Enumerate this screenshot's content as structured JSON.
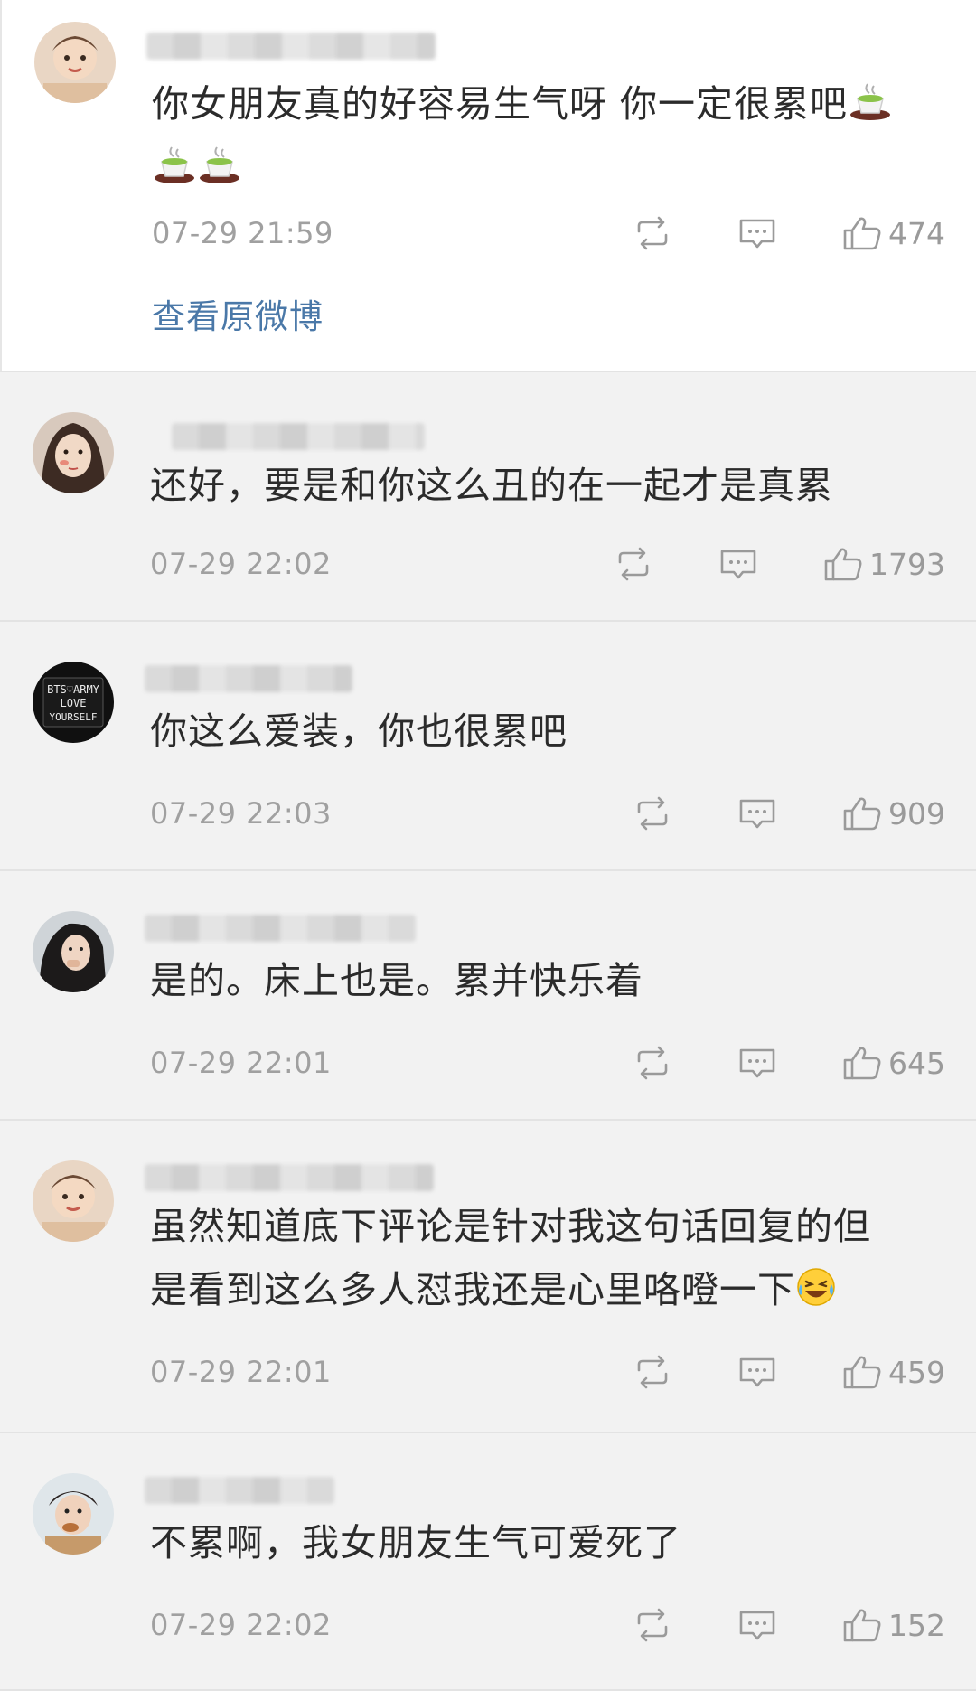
{
  "comments": [
    {
      "text": "你女朋友真的好容易生气呀 你一定很累吧",
      "emoji_after": [
        "tea-emoji",
        "tea-emoji",
        "tea-emoji"
      ],
      "time": "07-29 21:59",
      "likes": "474",
      "view_original": "查看原微博"
    },
    {
      "text": "还好，要是和你这么丑的在一起才是真累",
      "time": "07-29 22:02",
      "likes": "1793"
    },
    {
      "text": "你这么爱装，你也很累吧",
      "time": "07-29 22:03",
      "likes": "909",
      "avatar_text": [
        "BTS♡ARMY",
        "LOVE",
        "YOURSELF"
      ]
    },
    {
      "text": "是的。床上也是。累并快乐着",
      "time": "07-29 22:01",
      "likes": "645"
    },
    {
      "text_line1": "虽然知道底下评论是针对我这句话回复的但",
      "text_line2": "是看到这么多人怼我还是心里咯噔一下",
      "emoji_after": "laugh-cry-emoji",
      "time": "07-29 22:01",
      "likes": "459"
    },
    {
      "text": "不累啊，我女朋友生气可爱死了",
      "time": "07-29 22:02",
      "likes": "152"
    }
  ],
  "colors": {
    "link": "#4a78a8",
    "meta": "#a0a0a0",
    "bg": "#f2f2f2",
    "card": "#ffffff"
  },
  "icons": {
    "repost": "repost-icon",
    "reply": "comment-icon",
    "like": "thumbs-up-icon"
  }
}
